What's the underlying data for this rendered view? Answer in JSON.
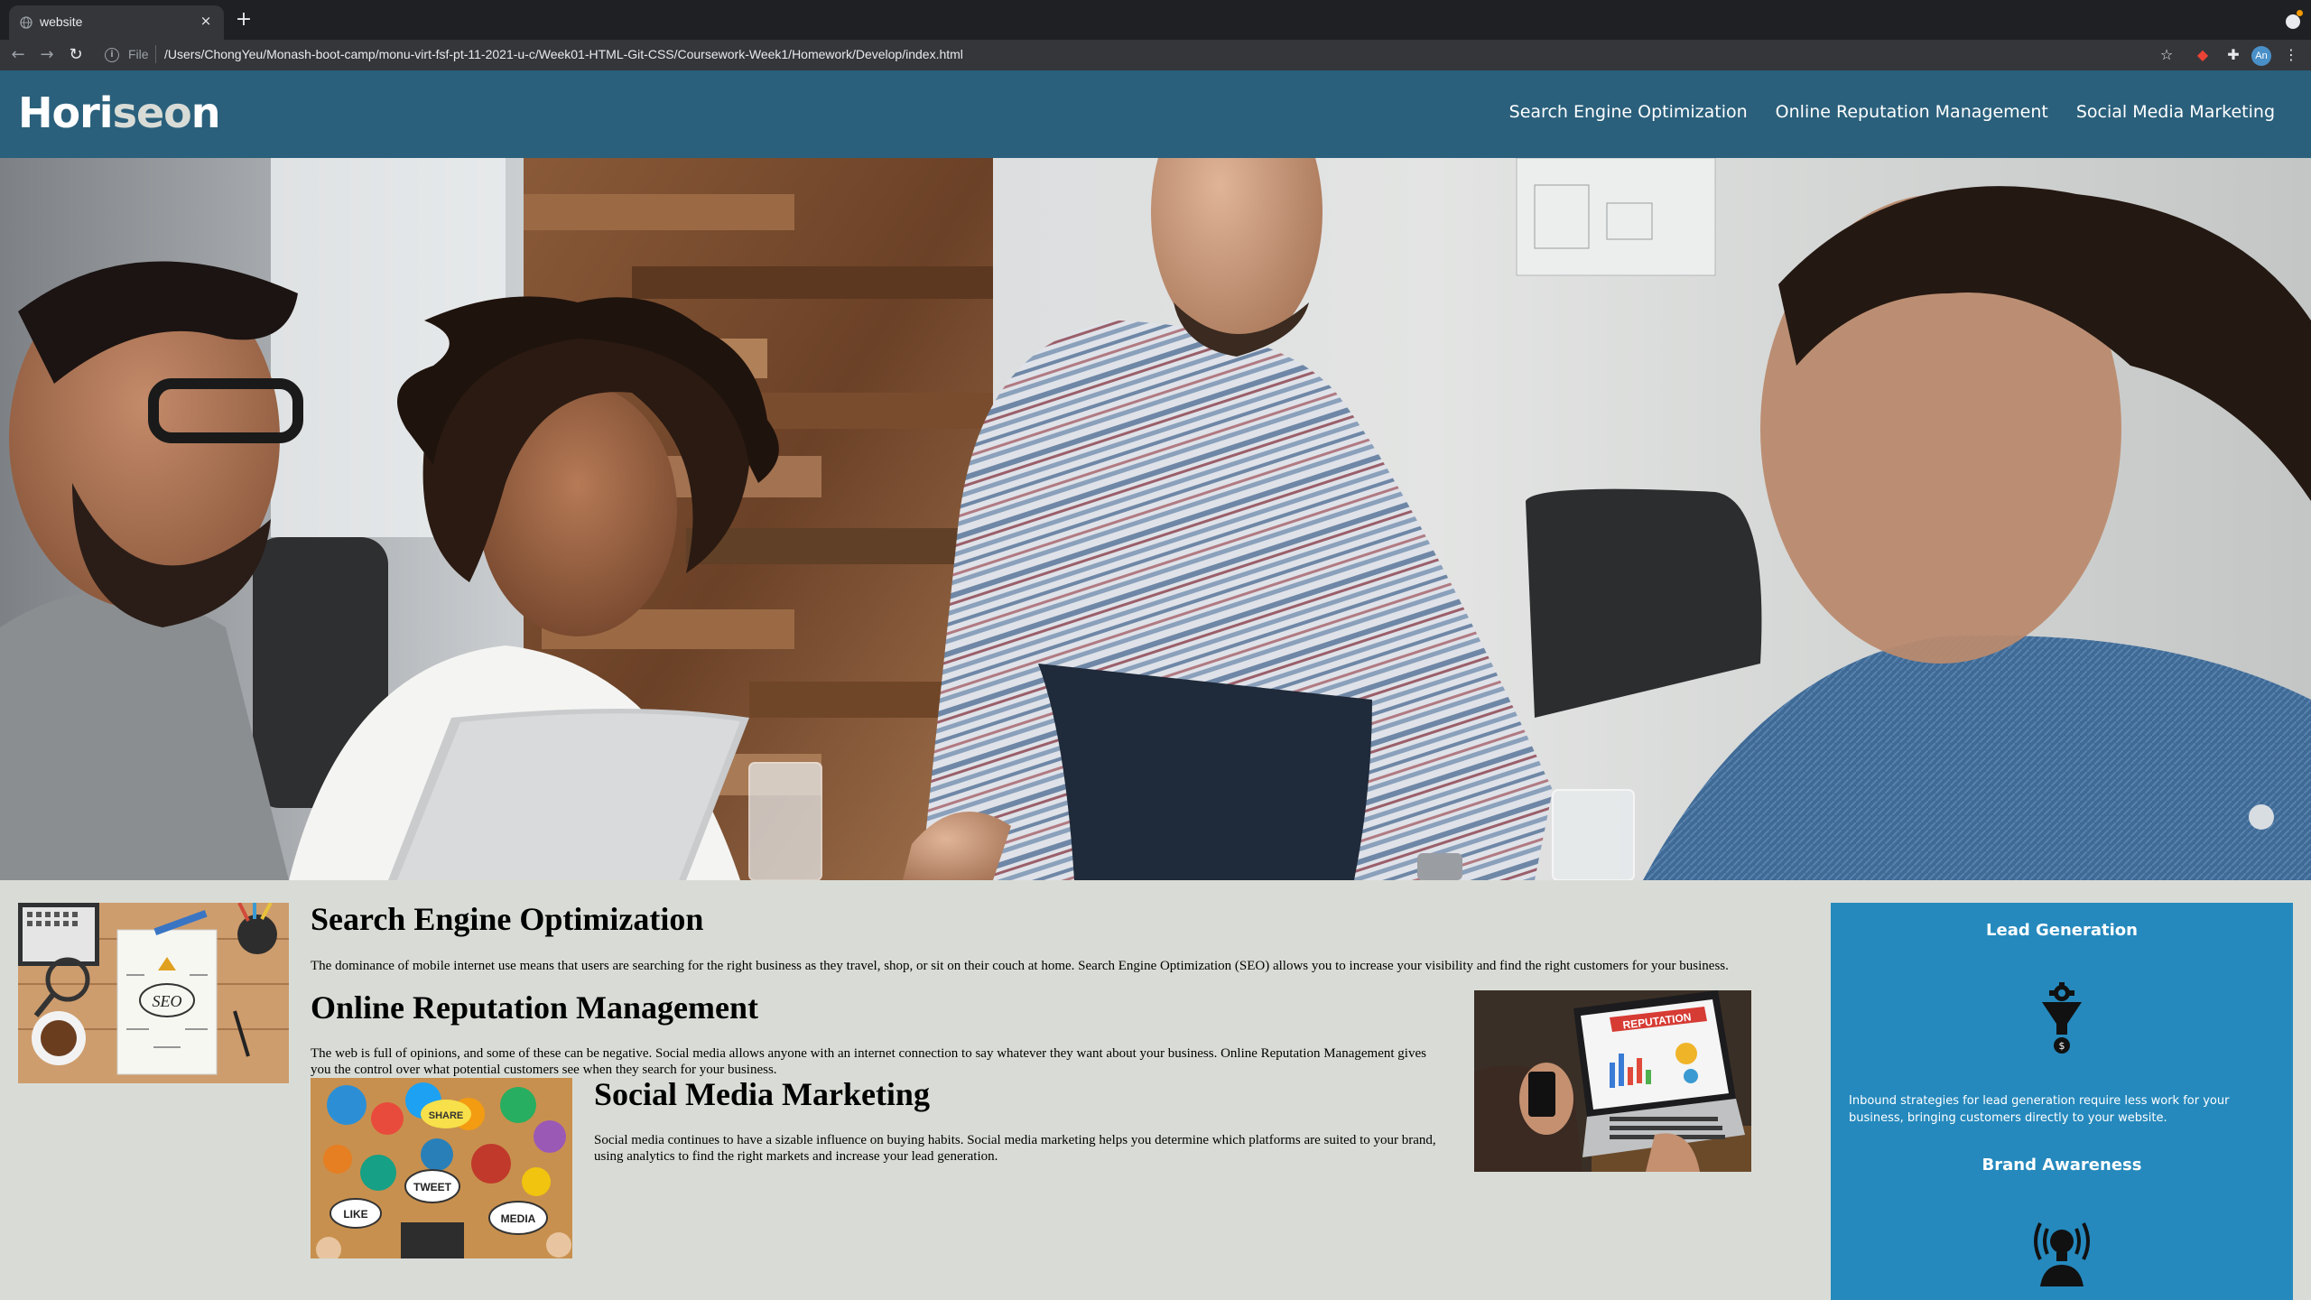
{
  "browser": {
    "tab_title": "website",
    "tab_close": "×",
    "new_tab": "+",
    "url_scheme": "File",
    "url": "/Users/ChongYeu/Monash-boot-camp/monu-virt-fsf-pt-11-2021-u-c/Week01-HTML-Git-CSS/Coursework-Week1/Homework/Develop/index.html",
    "profile_initials": "An",
    "icons": [
      "back-arrow-icon",
      "forward-arrow-icon",
      "reload-icon",
      "info-icon",
      "star-icon",
      "extension-icon",
      "puzzle-icon",
      "kebab-menu-icon"
    ]
  },
  "header": {
    "logo_main": "Hori",
    "logo_accent": "seo",
    "logo_end": "n",
    "nav": [
      {
        "label": "Search Engine Optimization"
      },
      {
        "label": "Online Reputation Management"
      },
      {
        "label": "Social Media Marketing"
      }
    ]
  },
  "articles": [
    {
      "title": "Search Engine Optimization",
      "body": "The dominance of mobile internet use means that users are searching for the right business as they travel, shop, or sit on their couch at home. Search Engine Optimization (SEO) allows you to increase your visibility and find the right customers for your business."
    },
    {
      "title": "Online Reputation Management",
      "body": "The web is full of opinions, and some of these can be negative. Social media allows anyone with an internet connection to say whatever they want about your business. Online Reputation Management gives you the control over what potential customers see when they search for your business."
    },
    {
      "title": "Social Media Marketing",
      "body": "Social media continues to have a sizable influence on buying habits. Social media marketing helps you determine which platforms are suited to your brand, using analytics to find the right markets and increase your lead generation."
    }
  ],
  "image_text": {
    "seo": "SEO",
    "reputation": "REPUTATION",
    "tweet": "TWEET",
    "like": "LIKE",
    "media": "MEDIA",
    "share": "SHARE"
  },
  "aside": {
    "items": [
      {
        "title": "Lead Generation",
        "body": "Inbound strategies for lead generation require less work for your business, bringing customers directly to your website.",
        "icon": "funnel-gear-icon"
      },
      {
        "title": "Brand Awareness",
        "icon": "lightbulb-broadcast-icon"
      }
    ]
  },
  "colors": {
    "header_bg": "#2a607c",
    "page_bg": "#d9dcd6",
    "aside_bg": "#2589bd",
    "chrome_dark": "#1f2023",
    "chrome_toolbar": "#35363a"
  }
}
